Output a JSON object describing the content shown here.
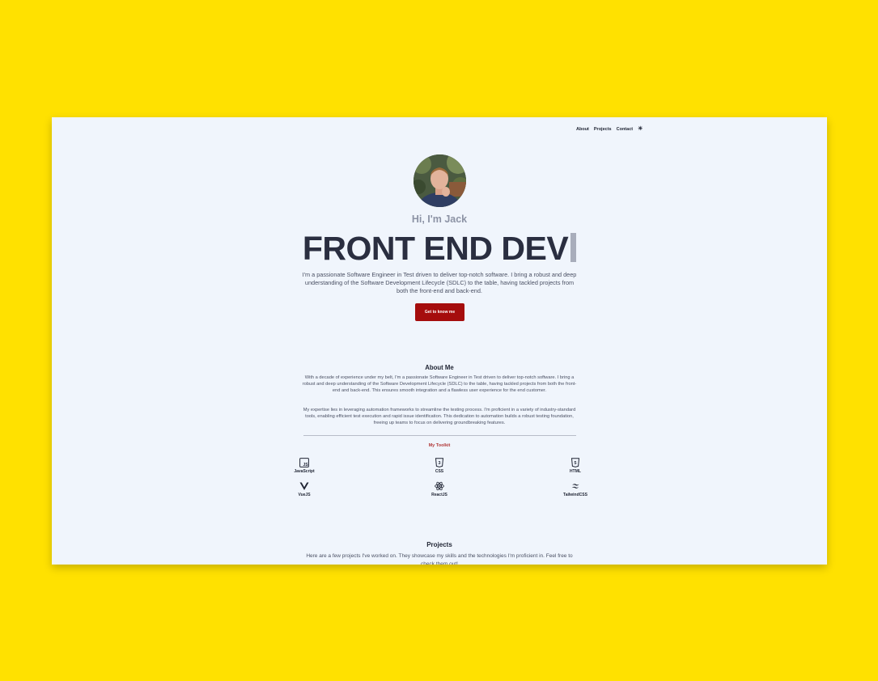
{
  "nav": {
    "items": [
      {
        "label": "About"
      },
      {
        "label": "Projects"
      },
      {
        "label": "Contact"
      }
    ],
    "theme_icon": "sun-icon"
  },
  "hero": {
    "greeting": "Hi, I'm Jack",
    "headline": "FRONT END DEV",
    "intro": "I'm a passionate Software Engineer in Test driven to deliver top-notch software. I bring a robust and deep understanding of the Software Development Lifecycle (SDLC) to the table, having tackled projects from both the front-end and back-end.",
    "cta_label": "Get to know me"
  },
  "about": {
    "title": "About Me",
    "p1": "With a decade of experience under my belt, I'm a passionate Software Engineer in Test driven to deliver top-notch software. I bring a robust and deep understanding of the Software Development Lifecycle (SDLC) to the table, having tackled projects from both the front-end and back-end. This ensures smooth integration and a flawless user experience for the end customer.",
    "p2": "My expertise lies in leveraging automation frameworks to streamline the testing process. I'm proficient in a variety of industry-standard tools, enabling efficient test execution and rapid issue identification. This dedication to automation builds a robust testing foundation, freeing up teams to focus on delivering groundbreaking features."
  },
  "toolkit": {
    "title": "My Toolkit",
    "items": [
      {
        "label": "JavaScript",
        "icon": "javascript-icon"
      },
      {
        "label": "CSS",
        "icon": "css3-icon"
      },
      {
        "label": "HTML",
        "icon": "html5-icon"
      },
      {
        "label": "VueJS",
        "icon": "vue-icon"
      },
      {
        "label": "ReactJS",
        "icon": "react-icon"
      },
      {
        "label": "TailwindCSS",
        "icon": "tailwind-icon"
      }
    ]
  },
  "projects": {
    "title": "Projects",
    "intro": "Here are a few projects I've worked on. They showcase my skills and the technologies I'm proficient in. Feel free to check them out!"
  },
  "colors": {
    "page_background": "#FFE100",
    "content_background": "#F0F5FC",
    "cta": "#A50D0D",
    "headline": "#2A2E40"
  }
}
